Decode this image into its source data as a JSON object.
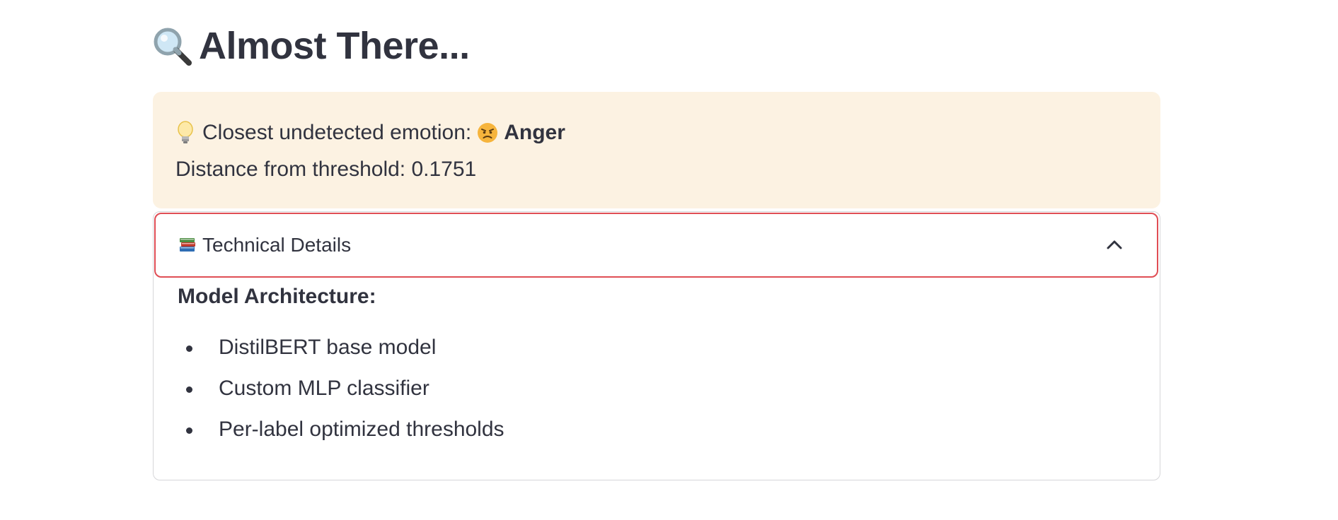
{
  "header": {
    "title": "Almost There...",
    "icon": "magnifying-glass-icon"
  },
  "warning": {
    "icon": "light-bulb-icon",
    "closest_label": "Closest undetected emotion:",
    "emotion_icon": "angry-face-icon",
    "emotion_name": "Anger",
    "distance_text": "Distance from threshold: 0.1751",
    "background_color": "#fcf2e2"
  },
  "expander": {
    "icon": "books-icon",
    "label": "Technical Details",
    "expanded": true,
    "focus_color": "#e04e55",
    "section_title": "Model Architecture:",
    "items": [
      "DistilBERT base model",
      "Custom MLP classifier",
      "Per-label optimized thresholds"
    ]
  }
}
